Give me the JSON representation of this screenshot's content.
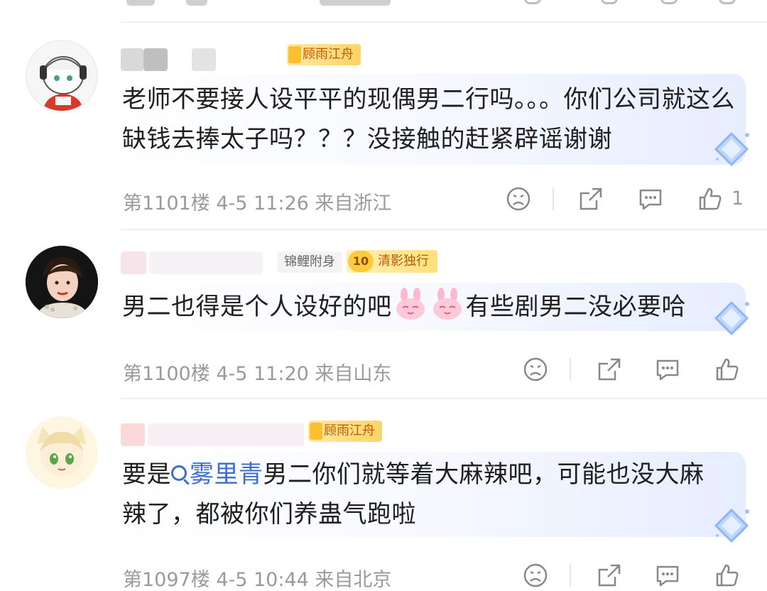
{
  "comments": [
    {
      "badges": [
        "顾雨江舟"
      ],
      "text": "老师不要接人设平平的现偶男二行吗。。。你们公司就这么缺钱去捧太子吗？？？没接触的赶紧辟谣谢谢",
      "floor": "第1101楼",
      "time": "4-5 11:26",
      "location": "来自浙江",
      "likes": "1"
    },
    {
      "badges": [
        "锦鲤附身",
        "清影独行"
      ],
      "level": "10",
      "text_parts": [
        "男二也得是个人设好的吧",
        "有些剧男二没必要哈"
      ],
      "emoji": "bunny-emoji",
      "floor": "第1100楼",
      "time": "4-5 11:20",
      "location": "来自山东",
      "likes": ""
    },
    {
      "badges": [
        "顾雨江舟"
      ],
      "text_before": "要是",
      "mention": "雾里青",
      "text_after": "男二你们就等着大麻辣吧，可能也没大麻辣了，都被你们养蛊气跑啦",
      "floor": "第1097楼",
      "time": "4-5 10:44",
      "location": "来自北京",
      "likes": ""
    }
  ],
  "icons": [
    "dislike-icon",
    "share-icon",
    "reply-icon",
    "like-icon",
    "diamond-gem-icon",
    "search-mention-icon"
  ],
  "colors": {
    "badge_text": "#c25a00",
    "mention": "#3a6ecf",
    "meta": "#9a9a9a",
    "bubble_tint": "#e6edff"
  }
}
